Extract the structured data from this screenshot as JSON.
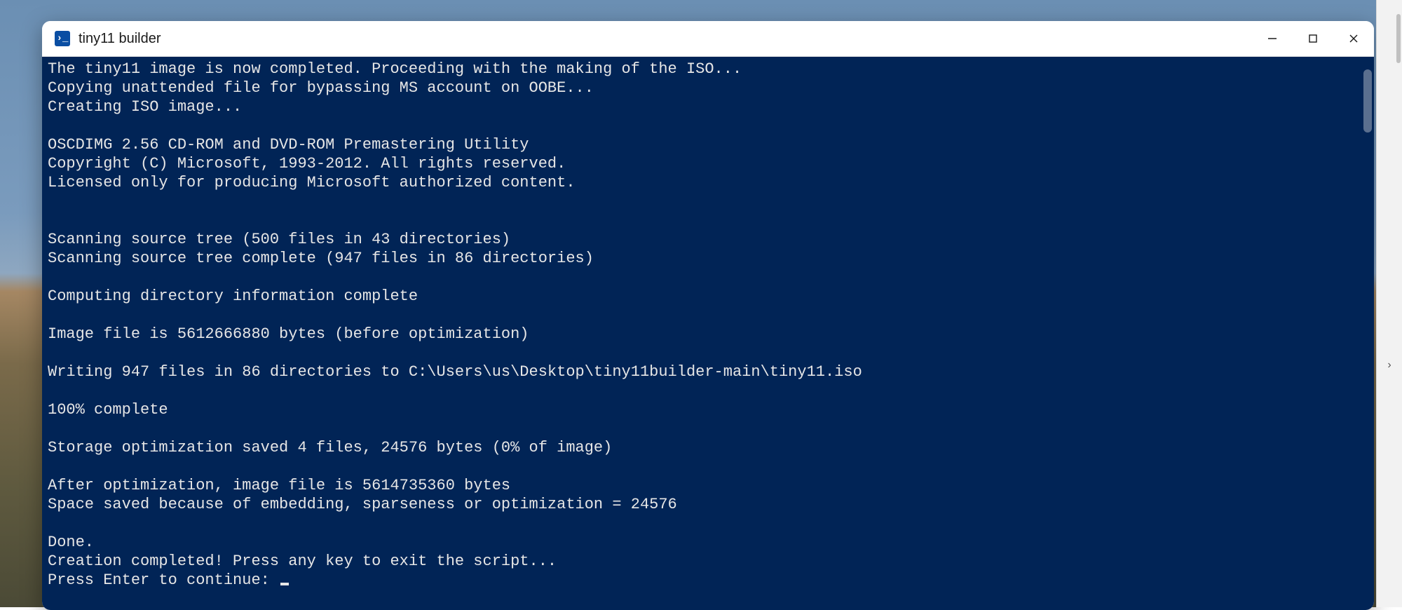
{
  "window": {
    "title": "tiny11 builder"
  },
  "terminal": {
    "lines": [
      "The tiny11 image is now completed. Proceeding with the making of the ISO...",
      "Copying unattended file for bypassing MS account on OOBE...",
      "Creating ISO image...",
      "",
      "OSCDIMG 2.56 CD-ROM and DVD-ROM Premastering Utility",
      "Copyright (C) Microsoft, 1993-2012. All rights reserved.",
      "Licensed only for producing Microsoft authorized content.",
      "",
      "",
      "Scanning source tree (500 files in 43 directories)",
      "Scanning source tree complete (947 files in 86 directories)",
      "",
      "Computing directory information complete",
      "",
      "Image file is 5612666880 bytes (before optimization)",
      "",
      "Writing 947 files in 86 directories to C:\\Users\\us\\Desktop\\tiny11builder-main\\tiny11.iso",
      "",
      "100% complete",
      "",
      "Storage optimization saved 4 files, 24576 bytes (0% of image)",
      "",
      "After optimization, image file is 5614735360 bytes",
      "Space saved because of embedding, sparseness or optimization = 24576",
      "",
      "Done.",
      "Creation completed! Press any key to exit the script...",
      "Press Enter to continue: "
    ]
  },
  "right_panel": {
    "expand_hint": "›"
  }
}
